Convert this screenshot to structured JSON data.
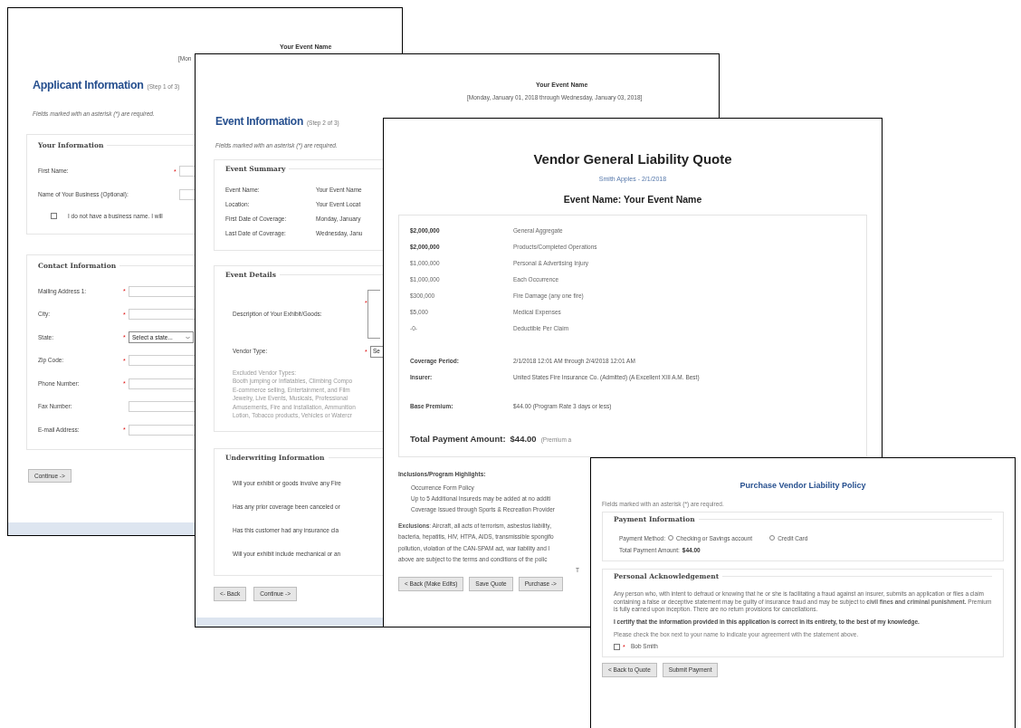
{
  "applicant_window": {
    "event_name": "Your Event Name",
    "event_dates": "[Mon",
    "title": "Applicant Information",
    "step": "(Step 1 of 3)",
    "note": "Fields marked with an asterisk (*) are required.",
    "your_information": {
      "legend": "Your Information",
      "fields": [
        {
          "label": "First Name:",
          "mark": "*"
        },
        {
          "label": "Name of Your Business (Optional):"
        }
      ],
      "checkbox": {
        "label": "I do not have a business name. I will",
        "checked": false
      }
    },
    "contact_information": {
      "legend": "Contact Information",
      "fields": [
        {
          "label": "Mailing Address 1:",
          "mark": "*",
          "kind": "input"
        },
        {
          "label": "City:",
          "mark": "*",
          "kind": "input"
        },
        {
          "label": "State:",
          "mark": "*",
          "kind": "select",
          "value": "Select a state..."
        },
        {
          "label": "Zip Code:",
          "mark": "*",
          "kind": "input"
        },
        {
          "label": "Phone Number:",
          "mark": "*",
          "kind": "input"
        },
        {
          "label": "Fax Number:",
          "kind": "input"
        },
        {
          "label": "E-mail Address:",
          "mark": "*",
          "kind": "input"
        }
      ]
    },
    "continue_button": "Continue ->"
  },
  "event_window": {
    "event_name": "Your Event Name",
    "event_dates": "[Monday, January 01, 2018 through Wednesday, January 03, 2018]",
    "title": "Event Information",
    "step": "(Step 2 of 3)",
    "note": "Fields marked with an asterisk (*) are required.",
    "summary": {
      "legend": "Event Summary",
      "rows": [
        {
          "label": "Event Name:",
          "value": "Your Event Name"
        },
        {
          "label": "Location:",
          "value": "Your Event Locat"
        },
        {
          "label": "First Date of Coverage:",
          "value": "Monday, January"
        },
        {
          "label": "Last Date of Coverage:",
          "value": "Wednesday, Janu"
        }
      ]
    },
    "details": {
      "legend": "Event Details",
      "description_label": "Description of Your Exhibit/Goods:",
      "description_mark": "*",
      "vendor_type_label": "Vendor Type:",
      "vendor_type_mark": "*",
      "vendor_type_value": "Se",
      "excluded_lines": [
        "Excluded Vendor Types:",
        "Booth jumping or Inflatables, Climbing Compo",
        "E-commerce selling, Entertainment, and Film",
        "Jewelry, Live Events, Musicals, Professional",
        "Amusements, Fire and Installation, Ammunition",
        "Lotion, Tobacco products, Vehicles or Watercr"
      ]
    },
    "underwriting": {
      "legend": "Underwriting Information",
      "questions": [
        "Will your exhibit or goods involve any Fire",
        "Has any prior coverage been canceled or",
        "Has this customer had any insurance cla",
        "Will your exhibit include mechanical or an"
      ]
    },
    "buttons": [
      "<- Back",
      "Continue ->"
    ]
  },
  "quote_window": {
    "title": "Vendor General Liability Quote",
    "subtitle": "Smith Apples - 2/1/2018",
    "event_heading": "Event Name: Your Event Name",
    "coverages": [
      {
        "amount": "$2,000,000",
        "emphasized": true,
        "description": "General Aggregate"
      },
      {
        "amount": "$2,000,000",
        "emphasized": true,
        "description": "Products/Completed Operations"
      },
      {
        "amount": "$1,000,000",
        "emphasized": false,
        "description": "Personal & Advertising Injury"
      },
      {
        "amount": "$1,000,000",
        "emphasized": false,
        "description": "Each Occurrence"
      },
      {
        "amount": "$300,000",
        "emphasized": false,
        "description": "Fire Damage (any one fire)"
      },
      {
        "amount": "$5,000",
        "emphasized": false,
        "description": "Medical Expenses"
      },
      {
        "amount": "-0-",
        "emphasized": false,
        "description": "Deductible Per Claim"
      }
    ],
    "coverage_period": {
      "label": "Coverage Period:",
      "value": "2/1/2018 12:01 AM through 2/4/2018 12:01 AM"
    },
    "insurer": {
      "label": "Insurer:",
      "value": "United States Fire Insurance Co. (Admitted) (A Excellent XIII A.M. Best)"
    },
    "base_premium": {
      "label": "Base Premium:",
      "value": "$44.00 (Program Rate 3 days or less)"
    },
    "total_label": "Total Payment Amount:",
    "total_value": "$44.00",
    "total_note": "(Premium a",
    "inclusions_heading": "Inclusions/Program Highlights:",
    "inclusions": [
      "Occurrence Form Policy",
      "Up to 5 Additional Insureds may be added at no additi",
      "Coverage Issued through Sports & Recreation Provider"
    ],
    "exclusions_lines": [
      "**Exclusions**: Aircraft, all acts of terrorism, asbestos liability,",
      "bacteria, hepatitis, HIV, HTPA, AIDS, transmissible spongifo",
      "pollution, violation of the CAN-SPAM act, war liability and l",
      "above are subject to the terms and conditions of the polic"
    ],
    "fragment": "T",
    "buttons": [
      "< Back (Make Edits)",
      "Save Quote",
      "Purchase ->"
    ]
  },
  "purchase_window": {
    "title": "Purchase Vendor Liability Policy",
    "note": "Fields marked with an asterisk (*) are required.",
    "payment": {
      "legend": "Payment Information",
      "method_label": "Payment Method:",
      "methods": [
        {
          "label": "Checking or Savings account",
          "selected": false
        },
        {
          "label": "Credit Card",
          "selected": false
        }
      ],
      "total_label": "Total Payment Amount:",
      "total_value": "$44.00"
    },
    "acknowledgement": {
      "legend": "Personal Acknowledgement",
      "disclaimer": "Any person who, with intent to defraud or knowing that he or she is facilitating a fraud against an insurer, submits an application or files a claim containing a false or deceptive statement may be guilty of insurance fraud and may be subject to **civil fines and criminal punishment.** Premium is fully earned upon inception. There are no return provisions for cancellations.",
      "certify": "I certify that the information provided in this application is correct in its entirety, to the best of my knowledge.",
      "instruction": "Please check the box next to your name to indicate your agreement with the statement above.",
      "signer": {
        "mark": "*",
        "name": "Bob Smith",
        "checked": false
      }
    },
    "buttons": [
      "< Back to Quote",
      "Submit Payment"
    ]
  }
}
